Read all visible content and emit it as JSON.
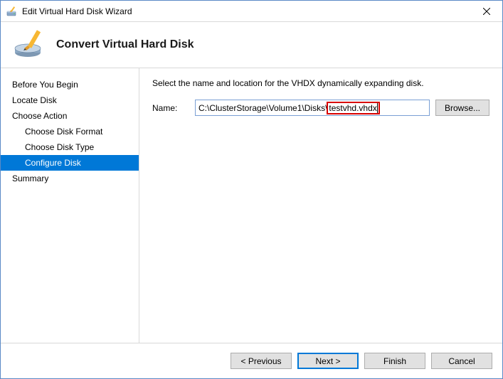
{
  "window": {
    "title": "Edit Virtual Hard Disk Wizard"
  },
  "header": {
    "title": "Convert Virtual Hard Disk"
  },
  "sidebar": {
    "items": [
      {
        "label": "Before You Begin",
        "sub": false,
        "selected": false
      },
      {
        "label": "Locate Disk",
        "sub": false,
        "selected": false
      },
      {
        "label": "Choose Action",
        "sub": false,
        "selected": false
      },
      {
        "label": "Choose Disk Format",
        "sub": true,
        "selected": false
      },
      {
        "label": "Choose Disk Type",
        "sub": true,
        "selected": false
      },
      {
        "label": "Configure Disk",
        "sub": true,
        "selected": true
      },
      {
        "label": "Summary",
        "sub": false,
        "selected": false
      }
    ]
  },
  "content": {
    "instruction": "Select the name and location for the VHDX dynamically expanding disk.",
    "name_label": "Name:",
    "path_prefix": "C:\\ClusterStorage\\Volume1\\Disks\\",
    "path_highlight": "testvhd.vhdx",
    "browse_label": "Browse..."
  },
  "footer": {
    "previous": "< Previous",
    "next": "Next >",
    "finish": "Finish",
    "cancel": "Cancel"
  }
}
